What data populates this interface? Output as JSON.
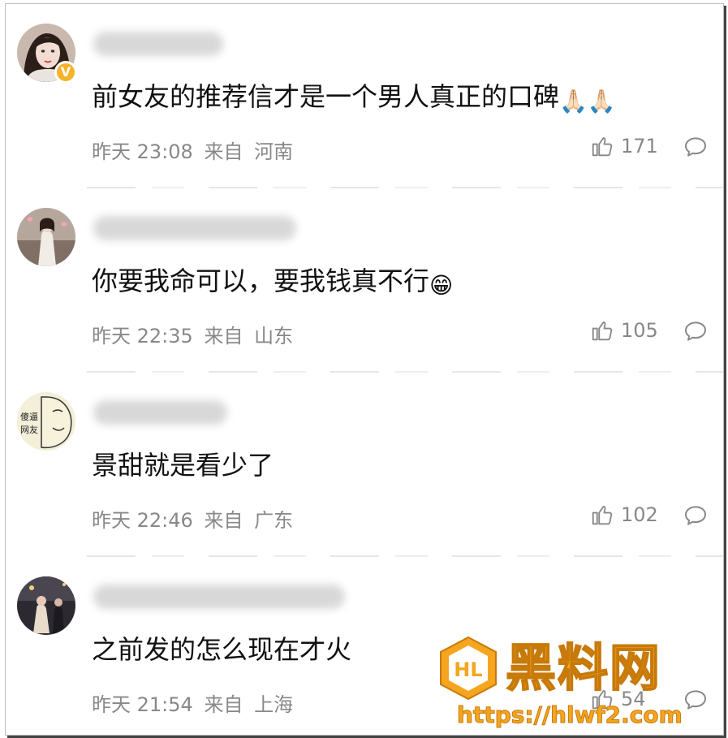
{
  "comments": [
    {
      "content": "前女友的推荐信才是一个男人真正的口碑",
      "emoji": "🙏🏻🙏🏻",
      "time": "昨天 23:08",
      "from_label": "来自",
      "location": "河南",
      "likes": "171",
      "verified": true
    },
    {
      "content": "你要我命可以，要我钱真不行",
      "emoji": "😁",
      "time": "昨天 22:35",
      "from_label": "来自",
      "location": "山东",
      "likes": "105",
      "verified": false
    },
    {
      "content": "景甜就是看少了",
      "emoji": "",
      "time": "昨天 22:46",
      "from_label": "来自",
      "location": "广东",
      "likes": "102",
      "verified": false
    },
    {
      "content": "之前发的怎么现在才火",
      "emoji": "",
      "time": "昨天 21:54",
      "from_label": "来自",
      "location": "上海",
      "likes": "54",
      "verified": false
    }
  ],
  "avatar3_text": [
    "傻逼",
    "网友"
  ],
  "icons": {
    "like": "thumbs-up-icon",
    "reply": "comment-bubble-icon",
    "verified": "verified-v-badge-icon"
  },
  "watermark": {
    "title": "黑料网",
    "url": "https://hlwf2.com",
    "logo_text": "HL"
  },
  "colors": {
    "meta_text": "#888888",
    "verified_badge": "#f6b22b",
    "watermark": "#f5a51e"
  }
}
